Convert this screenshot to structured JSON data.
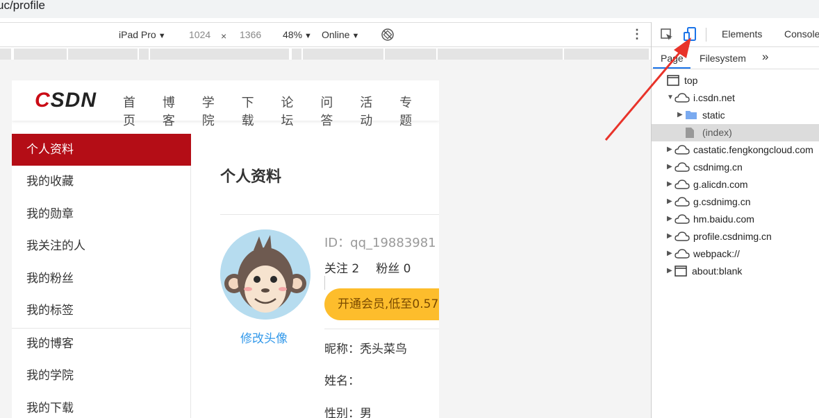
{
  "browser": {
    "url_fragment": "uc/profile"
  },
  "device_toolbar": {
    "device": "iPad Pro",
    "width": "1024",
    "times": "×",
    "height": "1366",
    "zoom": "48%",
    "network": "Online",
    "more": "⋮"
  },
  "site": {
    "logo_c": "C",
    "logo_rest": "SDN",
    "nav": [
      "首页",
      "博客",
      "学院",
      "下载",
      "论坛",
      "问答",
      "活动",
      "专题"
    ]
  },
  "sidebar": {
    "items": [
      "个人资料",
      "我的收藏",
      "我的勋章",
      "我关注的人",
      "我的粉丝",
      "我的标签",
      "我的博客",
      "我的学院",
      "我的下载"
    ]
  },
  "profile": {
    "title": "个人资料",
    "avatar_link": "修改头像",
    "id": "ID：qq_19883981",
    "following": "关注 2",
    "followers": "粉丝 0",
    "vip_button": "开通会员,低至0.57",
    "nickname": "昵称：秃头菜鸟",
    "realname": "姓名：",
    "gender": "性别：男"
  },
  "devtools": {
    "tabs": [
      "Elements",
      "Console"
    ],
    "subtabs": [
      "Page",
      "Filesystem",
      "»"
    ],
    "tree": [
      {
        "label": "top",
        "icon": "frame-icon"
      },
      {
        "label": "i.csdn.net",
        "icon": "cloud-icon"
      },
      {
        "label": "static",
        "icon": "folder-icon"
      },
      {
        "label": "(index)",
        "icon": "file-icon"
      },
      {
        "label": "castatic.fengkongcloud.com",
        "icon": "cloud-icon"
      },
      {
        "label": "csdnimg.cn",
        "icon": "cloud-icon"
      },
      {
        "label": "g.alicdn.com",
        "icon": "cloud-icon"
      },
      {
        "label": "g.csdnimg.cn",
        "icon": "cloud-icon"
      },
      {
        "label": "hm.baidu.com",
        "icon": "cloud-icon"
      },
      {
        "label": "profile.csdnimg.cn",
        "icon": "cloud-icon"
      },
      {
        "label": "webpack://",
        "icon": "cloud-icon"
      },
      {
        "label": "about:blank",
        "icon": "frame-icon"
      }
    ]
  },
  "colors": {
    "csdn_red": "#ca0c16",
    "sidebar_active": "#b40d16",
    "vip_yellow": "#fdbd2c",
    "link_blue": "#3399ea",
    "devtools_blue": "#1a73e8",
    "annotation_red": "#e8332a"
  }
}
